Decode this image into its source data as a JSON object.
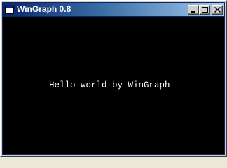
{
  "window": {
    "title": "WinGraph 0.8",
    "title_bar_color": "#0a246a",
    "client_background": "#000000"
  },
  "title_buttons": {
    "minimize_icon": "minimize-icon",
    "maximize_icon": "maximize-icon",
    "close_icon": "close-icon"
  },
  "canvas": {
    "text": "Hello world by WinGraph",
    "text_color": "#ffffff"
  }
}
